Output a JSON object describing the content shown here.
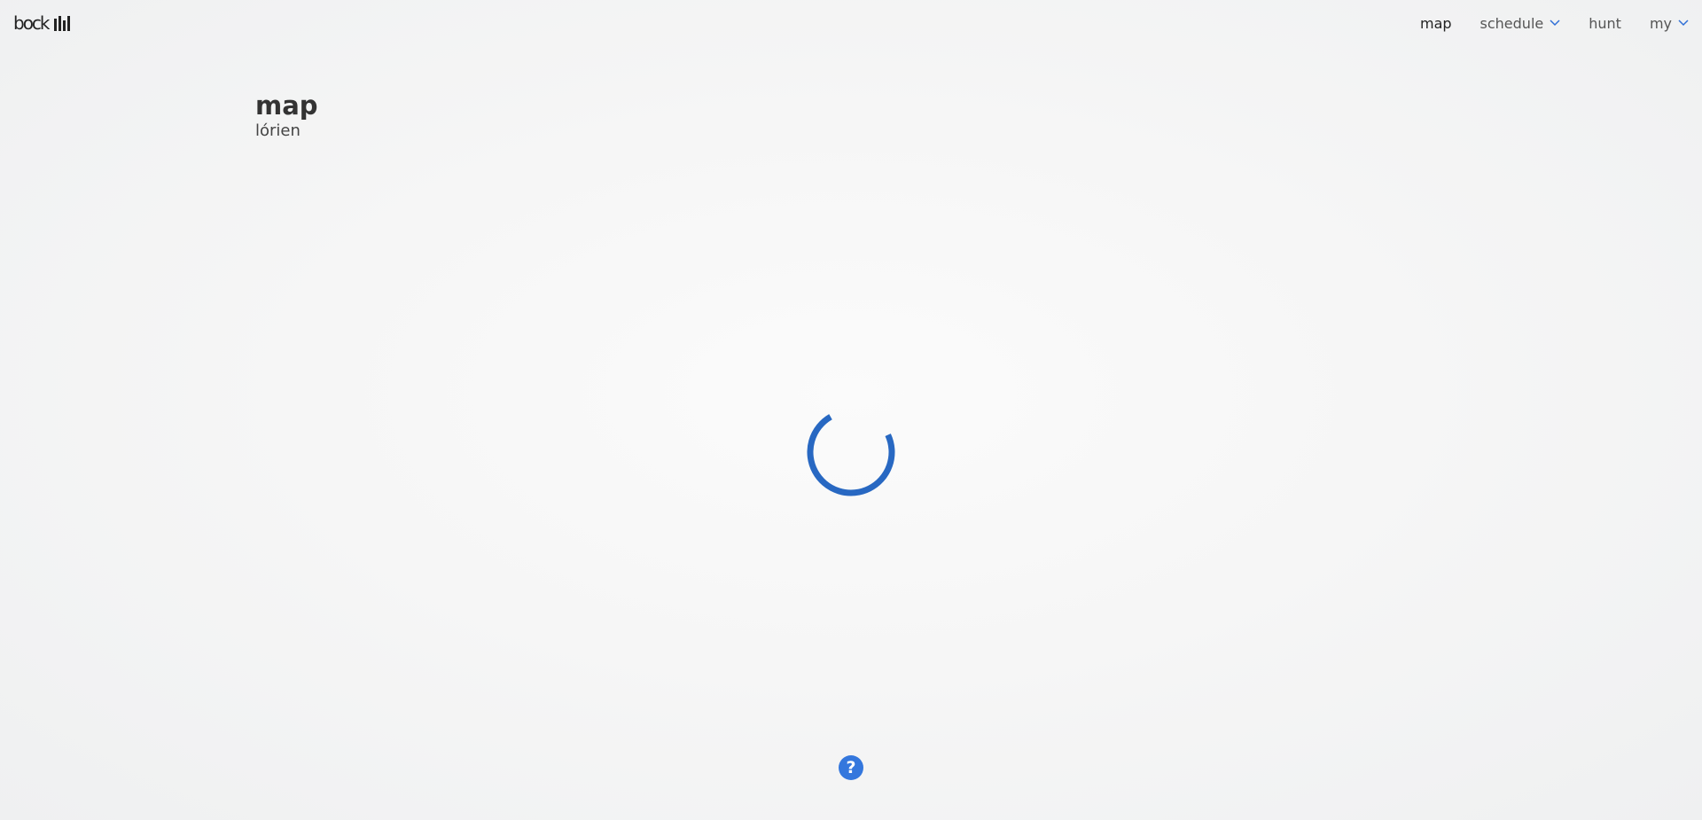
{
  "header": {
    "logo_text": "bock",
    "logo_icon": "bookshelf-icon",
    "nav": [
      {
        "label": "map",
        "has_dropdown": false
      },
      {
        "label": "schedule",
        "has_dropdown": true
      },
      {
        "label": "hunt",
        "has_dropdown": false
      },
      {
        "label": "my",
        "has_dropdown": true
      }
    ]
  },
  "main": {
    "title": "map",
    "subtitle": "lórien"
  },
  "loading": {
    "icon": "loading-spinner-icon",
    "color": "#2868c2"
  },
  "help": {
    "icon": "help-icon",
    "glyph": "?",
    "color": "#3477dd"
  }
}
